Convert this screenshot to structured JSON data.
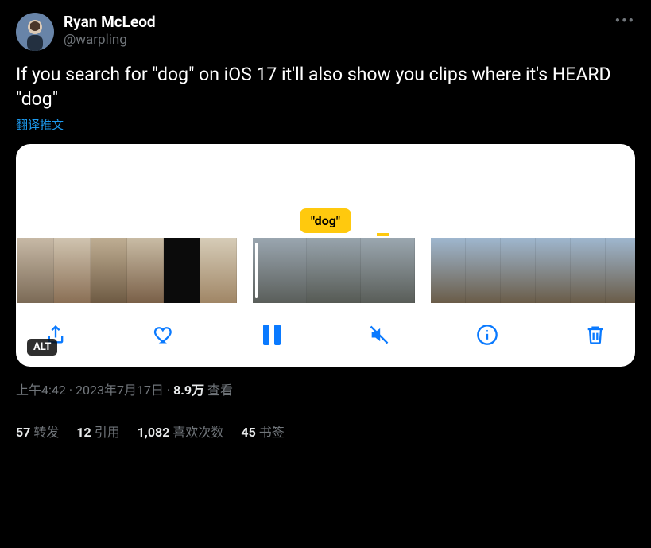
{
  "user": {
    "display_name": "Ryan McLeod",
    "handle": "@warpling"
  },
  "tweet_text": "If you search for \"dog\" on iOS 17 it'll also show you clips where it's HEARD \"dog\"",
  "translate_label": "翻译推文",
  "media": {
    "tag_text": "\"dog\"",
    "alt_badge": "ALT"
  },
  "meta": {
    "time": "上午4:42",
    "date": "2023年7月17日",
    "views_number": "8.9万",
    "views_label": "查看",
    "separator": " · "
  },
  "stats": {
    "retweets_number": "57",
    "retweets_label": "转发",
    "quotes_number": "12",
    "quotes_label": "引用",
    "likes_number": "1,082",
    "likes_label": "喜欢次数",
    "bookmarks_number": "45",
    "bookmarks_label": "书签"
  }
}
